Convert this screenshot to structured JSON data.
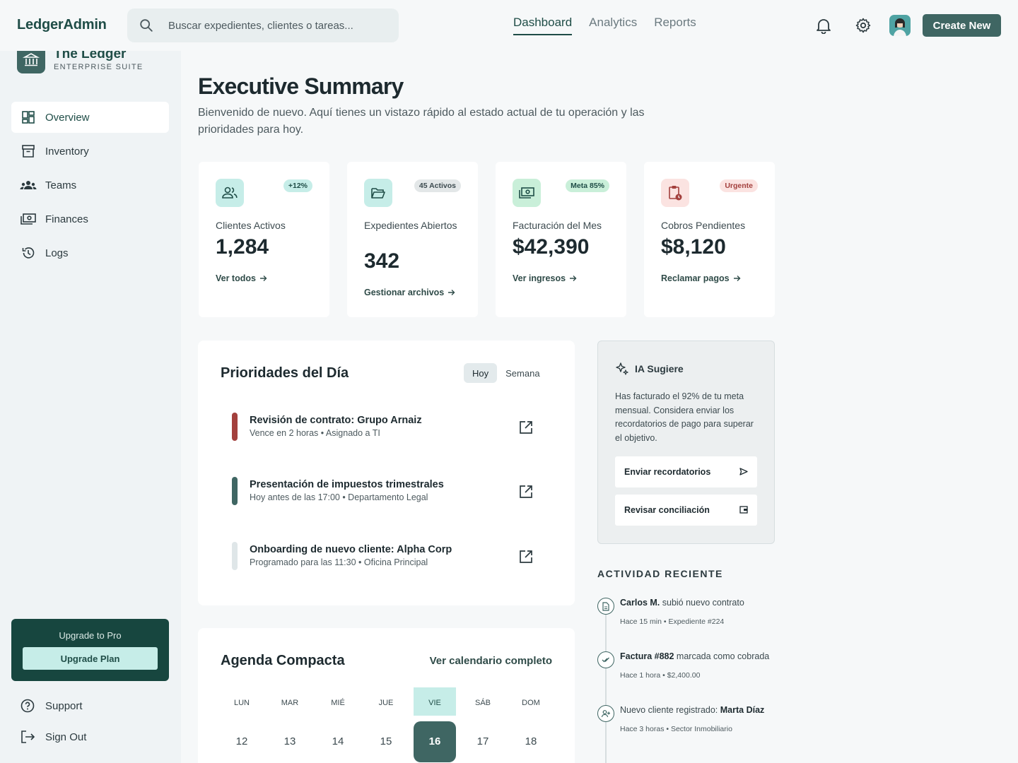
{
  "app": {
    "brand": "LedgerAdmin"
  },
  "search": {
    "placeholder": "Buscar expedientes, clientes o tareas..."
  },
  "topnav": {
    "items": [
      {
        "label": "Dashboard",
        "active": true
      },
      {
        "label": "Analytics"
      },
      {
        "label": "Reports"
      }
    ]
  },
  "header_icons": [
    "bell-icon",
    "gear-icon"
  ],
  "create_button": "Create New",
  "sidebar": {
    "title": "The Ledger",
    "subtitle": "ENTERPRISE SUITE",
    "items": [
      {
        "label": "Overview",
        "icon": "dashboard-icon",
        "active": true
      },
      {
        "label": "Inventory",
        "icon": "archive-icon"
      },
      {
        "label": "Teams",
        "icon": "groups-icon"
      },
      {
        "label": "Finances",
        "icon": "money-icon"
      },
      {
        "label": "Logs",
        "icon": "history-icon"
      }
    ],
    "upgrade": {
      "label": "Upgrade to Pro",
      "button": "Upgrade Plan"
    },
    "support": "Support",
    "signout": "Sign Out"
  },
  "page": {
    "title": "Executive Summary",
    "subtitle": "Bienvenido de nuevo. Aquí tienes un vistazo rápido al estado actual de tu operación y las prioridades para hoy."
  },
  "stats": [
    {
      "label": "Clientes Activos",
      "value": "1,284",
      "badge": "+12%",
      "link": "Ver todos",
      "icon": "users-icon"
    },
    {
      "label": "Expedientes Abiertos",
      "value": "342",
      "badge": "45 Activos",
      "link": "Gestionar archivos",
      "icon": "folder-icon"
    },
    {
      "label": "Facturación del Mes",
      "value": "$42,390",
      "badge": "Meta 85%",
      "link": "Ver ingresos",
      "icon": "money-icon"
    },
    {
      "label": "Cobros Pendientes",
      "value": "$8,120",
      "badge": "Urgente",
      "link": "Reclamar pagos",
      "icon": "pending-clipboard-icon"
    }
  ],
  "priorities": {
    "title": "Prioridades del Día",
    "tabs": [
      "Hoy",
      "Semana"
    ],
    "tasks": [
      {
        "title": "Revisión de contrato: Grupo Arnaiz",
        "meta": "Vence en 2 horas • Asignado a TI",
        "color": "#a3403d"
      },
      {
        "title": "Presentación de impuestos trimestrales",
        "meta": "Hoy antes de las 17:00 • Departamento Legal",
        "color": "#3f6663"
      },
      {
        "title": "Onboarding de nuevo cliente: Alpha Corp",
        "meta": "Programado para las 11:30 • Oficina Principal",
        "color": "#dfe6e8"
      }
    ]
  },
  "agenda": {
    "title": "Agenda Compacta",
    "link": "Ver calendario completo",
    "days": [
      "LUN",
      "MAR",
      "MIÉ",
      "JUE",
      "VIE",
      "SÁB",
      "DOM"
    ],
    "dates": [
      "12",
      "13",
      "14",
      "15",
      "16",
      "17",
      "18"
    ],
    "today_index": 4
  },
  "ia": {
    "title": "IA Sugiere",
    "text": "Has facturado el 92% de tu meta mensual. Considera enviar los recordatorios de pago para superar el objetivo.",
    "actions": [
      {
        "label": "Enviar recordatorios",
        "icon": "send-icon"
      },
      {
        "label": "Revisar conciliación",
        "icon": "wallet-icon"
      }
    ]
  },
  "activity": {
    "title": "ACTIVIDAD RECIENTE",
    "items": [
      {
        "bold": "Carlos M.",
        "rest": " subió nuevo contrato",
        "meta": "Hace 15 min • Expediente #224",
        "icon": "document-icon"
      },
      {
        "bold": "Factura #882",
        "rest": " marcada como cobrada",
        "meta": "Hace 1 hora • $2,400.00",
        "icon": "check-icon"
      },
      {
        "pre": "Nuevo cliente registrado: ",
        "bold": "Marta Díaz",
        "meta": "Hace 3 horas • Sector Inmobiliario",
        "icon": "person-add-icon"
      }
    ]
  },
  "colors": {
    "accent": "#3f6663",
    "brand": "#1f4d47",
    "danger": "#a3403d",
    "mint": "#c6ede8"
  }
}
